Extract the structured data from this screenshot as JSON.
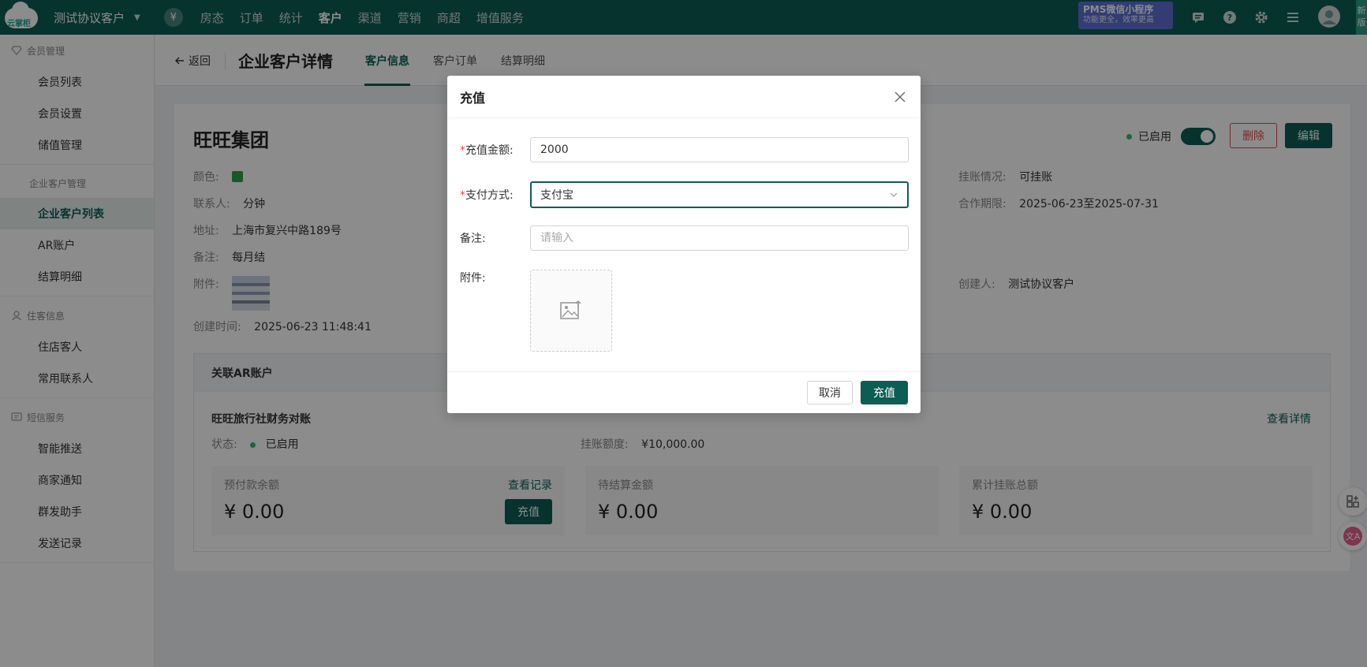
{
  "topbar": {
    "logo_text": "云掌柜",
    "store_name": "测试协议客户",
    "currency_icon": "yen-icon",
    "nav": [
      "房态",
      "订单",
      "统计",
      "客户",
      "渠道",
      "营销",
      "商超",
      "增值服务"
    ],
    "active_nav": "客户",
    "promo_line1": "PMS微信小程序",
    "promo_line2": "功能更全，效率更高",
    "new_tag": "新版"
  },
  "sidebar": {
    "group_member": "会员管理",
    "member_items": [
      "会员列表",
      "会员设置",
      "储值管理"
    ],
    "sub_enterprise": "企业客户管理",
    "enterprise_items": [
      "企业客户列表",
      "AR账户",
      "结算明细"
    ],
    "group_guest": "住客信息",
    "guest_items": [
      "住店客人",
      "常用联系人"
    ],
    "group_sms": "短信服务",
    "sms_items": [
      "智能推送",
      "商家通知",
      "群发助手",
      "发送记录"
    ]
  },
  "header": {
    "back": "返回",
    "title": "企业客户详情",
    "tabs": [
      "客户信息",
      "客户订单",
      "结算明细"
    ]
  },
  "customer": {
    "name": "旺旺集团",
    "status": "已启用",
    "delete": "删除",
    "edit": "编辑",
    "color_label": "颜色:",
    "color_value": "#2ea043",
    "contact_label": "联系人:",
    "contact": "分钟",
    "address_label": "地址:",
    "address": "上海市复兴中路189号",
    "remark_label": "备注:",
    "remark": "每月结",
    "attach_label": "附件:",
    "created_label": "创建时间:",
    "created": "2025-06-23 11:48:41",
    "credit_label": "挂账情况:",
    "credit": "可挂账",
    "period_label": "合作期限:",
    "period": "2025-06-23至2025-07-31",
    "creator_label": "创建人:",
    "creator": "测试协议客户"
  },
  "ar": {
    "header": "关联AR账户",
    "account_name": "旺旺旅行社财务对账",
    "detail_link": "查看详情",
    "status_label": "状态:",
    "status": "已启用",
    "limit_label": "挂账额度:",
    "limit": "¥10,000.00",
    "prepaid_label": "预付款余额",
    "prepaid": "¥ 0.00",
    "records_link": "查看记录",
    "recharge_button": "充值",
    "pending_label": "待结算金额",
    "pending": "¥ 0.00",
    "total_label": "累计挂账总额",
    "total": "¥ 0.00"
  },
  "modal": {
    "title": "充值",
    "amount_label": "充值金额:",
    "amount_value": "2000",
    "pay_label": "支付方式:",
    "pay_value": "支付宝",
    "note_label": "备注:",
    "note_placeholder": "请输入",
    "attach_label": "附件:",
    "cancel": "取消",
    "confirm": "充值"
  }
}
